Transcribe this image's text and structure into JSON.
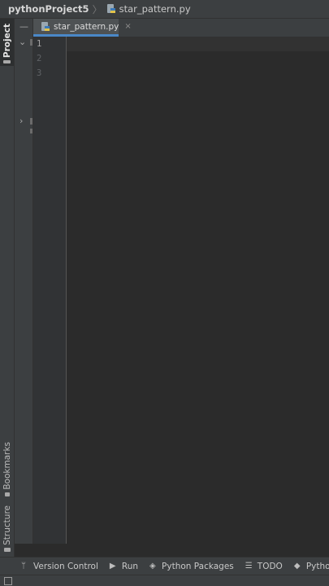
{
  "navbar": {
    "project": "pythonProject5",
    "separator": "〉",
    "file": "star_pattern.py",
    "file_icon": "python-file-icon"
  },
  "left_stripe": {
    "project_label": "Project",
    "bookmarks_label": "Bookmarks",
    "structure_label": "Structure"
  },
  "tabs": [
    {
      "label": "star_pattern.py",
      "close": "×",
      "icon": "python-file-icon"
    }
  ],
  "editor": {
    "line_numbers": [
      "1",
      "2",
      "3"
    ]
  },
  "bottom_bar": {
    "items": [
      {
        "label": "Version Control",
        "icon": "branch-icon"
      },
      {
        "label": "Run",
        "icon": "play-icon"
      },
      {
        "label": "Python Packages",
        "icon": "layers-icon"
      },
      {
        "label": "TODO",
        "icon": "list-icon"
      },
      {
        "label": "Python Console",
        "icon": "python-console-icon"
      }
    ]
  },
  "colors": {
    "accent": "#4a88c7",
    "editor_bg": "#2b2b2b",
    "panel_bg": "#3c3f41"
  }
}
